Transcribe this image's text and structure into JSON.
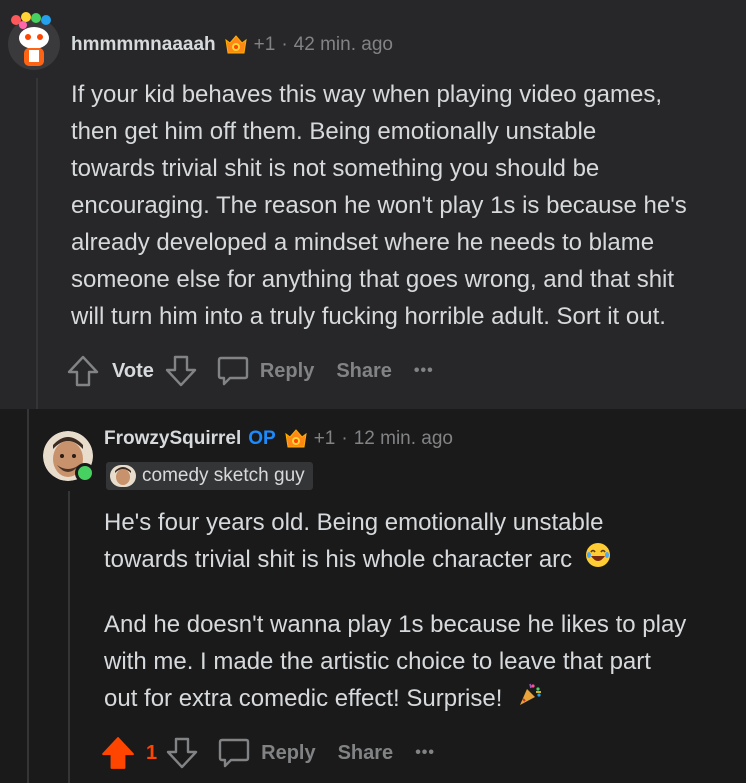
{
  "parent_comment": {
    "username": "hmmmmnaaaah",
    "award_count": "+1",
    "separator": "·",
    "time": "42 min. ago",
    "body": [
      "If your kid behaves this way when playing video games,",
      "then get him off them. Being emotionally unstable",
      "towards trivial shit is not something you should be",
      "encouraging. The reason he won't play 1s is because he's",
      "already developed a mindset where he needs to blame",
      "someone else for anything that goes wrong, and that shit",
      "will turn him into a truly fucking horrible adult. Sort it out."
    ],
    "actions": {
      "vote_label": "Vote",
      "reply_label": "Reply",
      "share_label": "Share",
      "more_label": "•••"
    }
  },
  "reply_comment": {
    "username": "FrowzySquirrel",
    "op_badge": "OP",
    "award_count": "+1",
    "separator": "·",
    "time": "12 min. ago",
    "flair": "comedy sketch guy",
    "body": {
      "para1_line1": "He's four years old. Being emotionally unstable",
      "para1_line2": "towards trivial shit is his whole character arc",
      "para2_line1": "And he doesn't wanna play 1s because he likes to play",
      "para2_line2": "with me. I made the artistic choice to leave that part",
      "para2_line3": "out for extra comedic effect! Surprise!"
    },
    "actions": {
      "vote_count": "1",
      "reply_label": "Reply",
      "share_label": "Share",
      "more_label": "•••"
    }
  },
  "colors": {
    "op_blue": "#1a8cff",
    "upvote_orange": "#ff4500",
    "online_green": "#46d160",
    "muted": "#818384"
  }
}
